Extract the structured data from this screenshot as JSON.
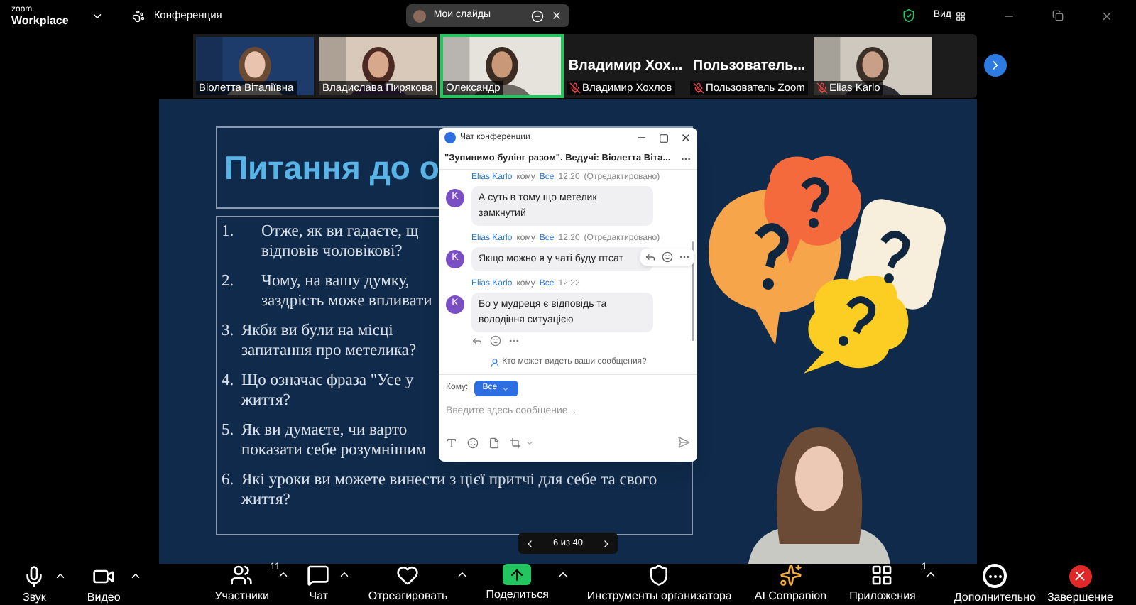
{
  "titlebar": {
    "logo_top": "zoom",
    "logo_bottom": "Workplace",
    "meeting": "Конференция",
    "share_pill": "Мои слайды",
    "view": "Вид"
  },
  "thumbnails": [
    {
      "kind": "video",
      "name": "Віолетта Віталіївна",
      "muted": false,
      "selected": false
    },
    {
      "kind": "video",
      "name": "Владислава Пирякова",
      "muted": false,
      "selected": false
    },
    {
      "kind": "video",
      "name": "Олександр",
      "muted": false,
      "selected": true
    },
    {
      "kind": "name",
      "title": "Владимир Хох...",
      "name": "Владимир Хохлов",
      "muted": true,
      "selected": false
    },
    {
      "kind": "name",
      "title": "Пользователь...",
      "name": "Пользователь Zoom",
      "muted": true,
      "selected": false
    },
    {
      "kind": "video",
      "name": "Elias Karlo",
      "muted": true,
      "selected": false
    }
  ],
  "slide": {
    "title": "Питання до о",
    "questions": [
      {
        "number": "1.",
        "lines": [
          "Отже, як ви гадаєте, щ",
          "відповів чоловікові?"
        ]
      },
      {
        "number": "2.",
        "lines": [
          "Чому, на вашу думку,",
          "заздрість може впливати"
        ]
      },
      {
        "number": "3.",
        "lines": [
          "Якби ви були на місці",
          "запитання про метелика?"
        ]
      },
      {
        "number": "4.",
        "lines": [
          "Що означає фраза \"Усе у",
          "життя?"
        ]
      },
      {
        "number": "5.",
        "lines": [
          "Як ви думаєте, чи варто",
          "показати себе розумнішим"
        ]
      },
      {
        "number": "6.",
        "lines": [
          "Які уроки ви можете винести з цієї притчі для себе та свого",
          "життя?"
        ]
      }
    ],
    "pager": "6 из 40"
  },
  "chat": {
    "title": "Чат конференции",
    "subtitle": "\"Зупинимо булінг разом\". Ведучі: Віолетта Віта...",
    "messages": [
      {
        "initial": "K",
        "sender": "Elias Karlo",
        "to": "кому",
        "recipient": "Все",
        "time": "12:20",
        "edited": "(Отредактировано)",
        "text": "А суть в тому що метелик замкнутий",
        "hovered": false,
        "reactions": false
      },
      {
        "initial": "K",
        "sender": "Elias Karlo",
        "to": "кому",
        "recipient": "Все",
        "time": "12:20",
        "edited": "(Отредактировано)",
        "text": "Якщо можно я у чаті буду птсат",
        "hovered": true,
        "reactions": false
      },
      {
        "initial": "K",
        "sender": "Elias Karlo",
        "to": "кому",
        "recipient": "Все",
        "time": "12:22",
        "text": "Бо у мудреця є відповідь та володіння ситуацією",
        "hovered": false,
        "reactions": true
      }
    ],
    "who_can_see": "Кто может видеть ваши сообщения?",
    "to_label": "Кому:",
    "to_value": "Все",
    "placeholder": "Введите здесь сообщение..."
  },
  "toolbar": [
    {
      "kind": "mic",
      "label": "Звук",
      "caret": true
    },
    {
      "kind": "video",
      "label": "Видео",
      "caret": true
    },
    {
      "kind": "participants",
      "label": "Участники",
      "count": "11",
      "caret": true
    },
    {
      "kind": "chat",
      "label": "Чат",
      "caret": true
    },
    {
      "kind": "react",
      "label": "Отреагировать",
      "caret": true
    },
    {
      "kind": "share",
      "label": "Поделиться",
      "caret": true
    },
    {
      "kind": "host",
      "label": "Инструменты организатора",
      "caret": false
    },
    {
      "kind": "ai",
      "label": "AI Companion",
      "caret": false
    },
    {
      "kind": "apps",
      "label": "Приложения",
      "count": "1",
      "caret": true
    },
    {
      "kind": "more",
      "label": "Дополнительно",
      "caret": false
    },
    {
      "kind": "end",
      "label": "Завершение",
      "caret": false
    }
  ]
}
